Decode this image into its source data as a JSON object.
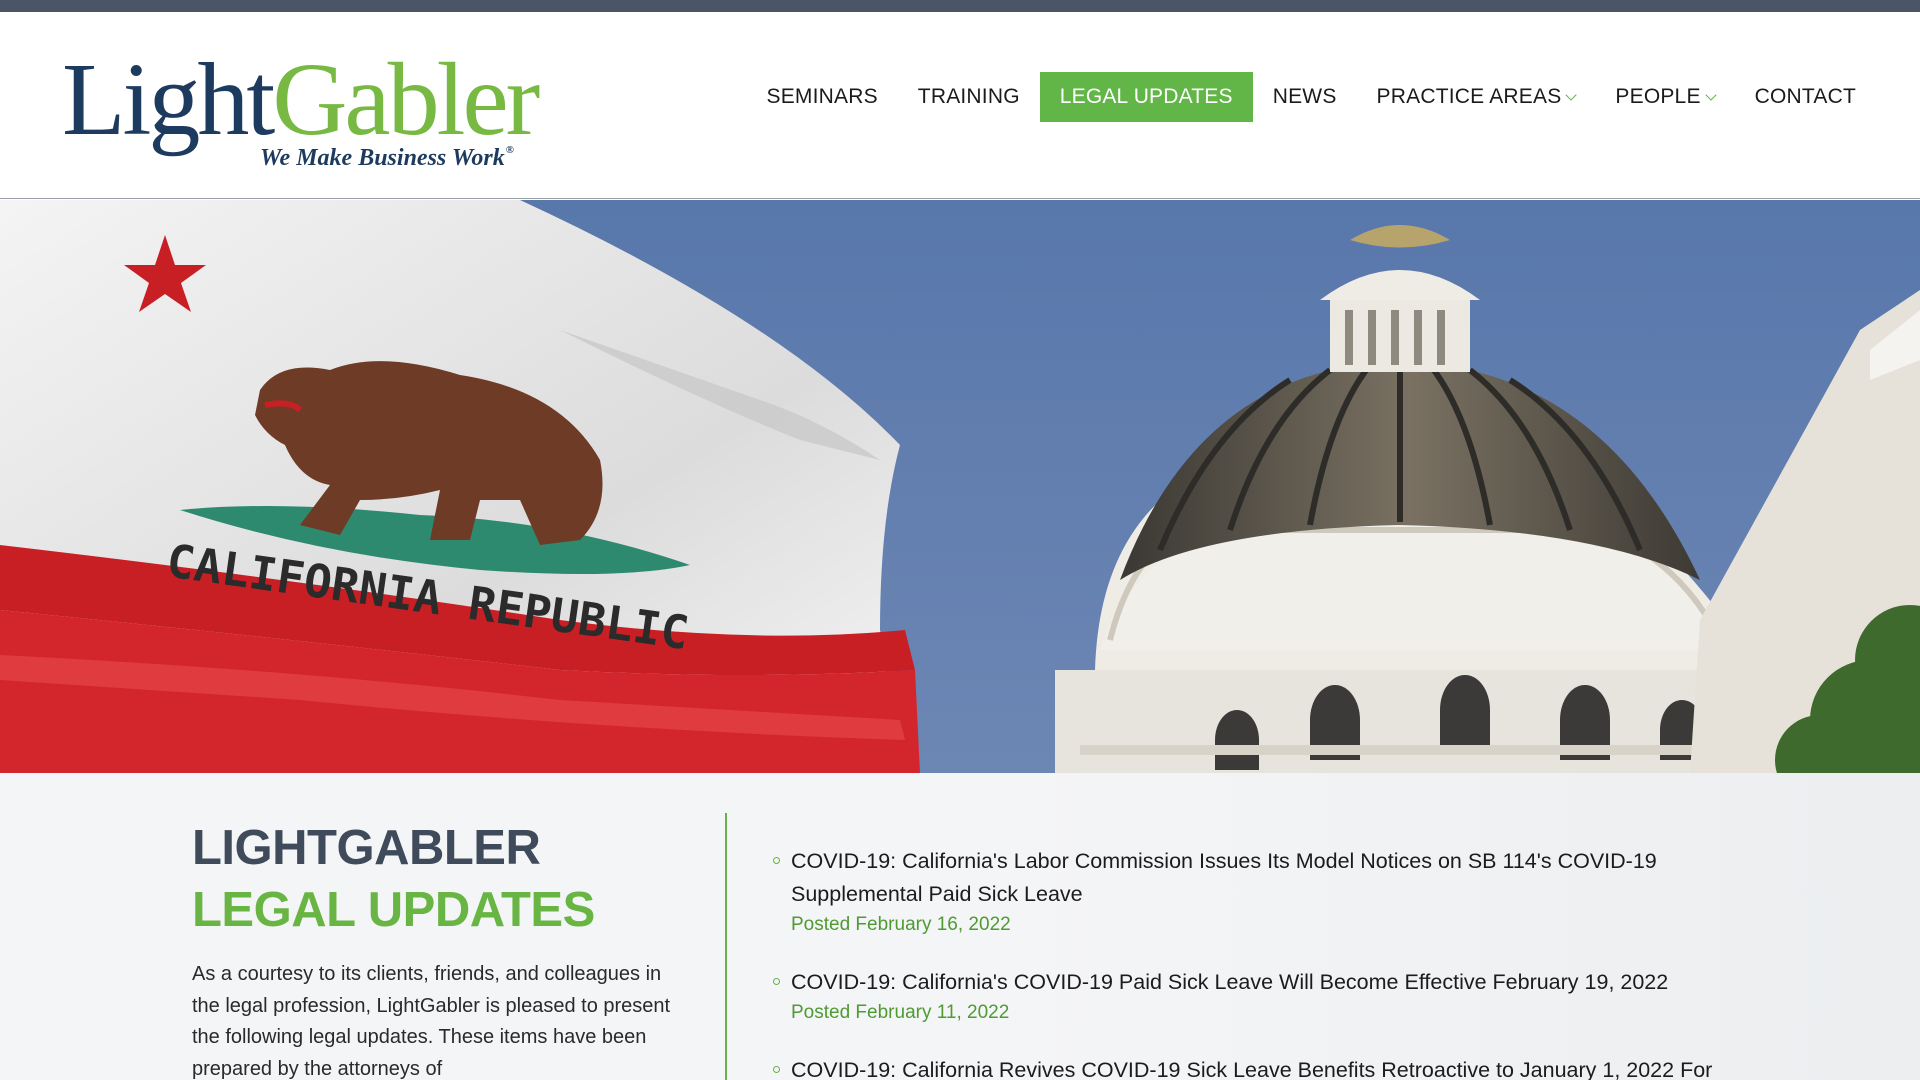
{
  "brand": {
    "logo_light": "Light",
    "logo_gabler": "Gabler",
    "tagline": "We Make Business Work",
    "registered_mark": "®",
    "colors": {
      "navy": "#1d3b5e",
      "green": "#62b547",
      "heading_gray": "#3f4a5a",
      "top_strip": "#4a5668"
    }
  },
  "nav": {
    "items": [
      {
        "label": "SEMINARS",
        "active": false,
        "dropdown": false
      },
      {
        "label": "TRAINING",
        "active": false,
        "dropdown": false
      },
      {
        "label": "LEGAL UPDATES",
        "active": true,
        "dropdown": false
      },
      {
        "label": "NEWS",
        "active": false,
        "dropdown": false
      },
      {
        "label": "PRACTICE AREAS",
        "active": false,
        "dropdown": true
      },
      {
        "label": "PEOPLE",
        "active": false,
        "dropdown": true
      },
      {
        "label": "CONTACT",
        "active": false,
        "dropdown": false
      }
    ]
  },
  "hero": {
    "flag_text": "CALIFORNIA REPUBLIC",
    "description_icon": "hero-photo-flag-and-capitol-dome"
  },
  "intro": {
    "heading_line1": "LIGHTGABLER",
    "heading_line2": "LEGAL UPDATES",
    "body": "As a courtesy to its clients, friends, and colleagues in the legal profession, LightGabler is pleased to present the following legal updates. These items have been prepared by the attorneys of"
  },
  "updates": [
    {
      "title": "COVID-19: California's Labor Commission Issues Its Model Notices on SB 114's COVID-19 Supplemental Paid Sick Leave",
      "date": "Posted February 16, 2022"
    },
    {
      "title": "COVID-19: California's COVID-19 Paid Sick Leave Will Become Effective February 19, 2022",
      "date": "Posted February 11, 2022"
    },
    {
      "title": "COVID-19: California Revives COVID-19 Sick Leave Benefits Retroactive to January 1, 2022 For",
      "date": ""
    }
  ]
}
